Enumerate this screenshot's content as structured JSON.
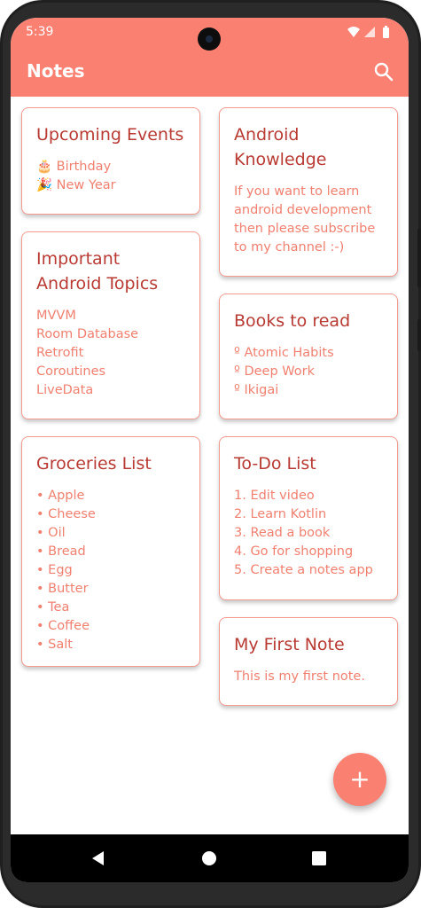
{
  "status_bar": {
    "time": "5:39",
    "icons": [
      "wifi-icon",
      "signal-icon",
      "battery-icon"
    ]
  },
  "app_bar": {
    "title": "Notes",
    "search_icon": "search-icon"
  },
  "colors": {
    "accent": "#fa8072",
    "title_text": "#b83a33",
    "body_text": "#f08070",
    "card_border": "#f39b8f"
  },
  "notes": [
    {
      "title": "Upcoming Events",
      "lines": [
        "🎂 Birthday",
        "🎉 New Year"
      ]
    },
    {
      "title": "Android Knowledge",
      "lines": [
        "If you want to learn",
        "android development",
        "then please subscribe",
        "to my channel :-)"
      ]
    },
    {
      "title": "Important Android Topics",
      "lines": [
        "MVVM",
        "Room Database",
        "Retrofit",
        "Coroutines",
        "LiveData"
      ]
    },
    {
      "title": "Books to read",
      "lines": [
        "º Atomic Habits",
        "º Deep Work",
        "º Ikigai"
      ]
    },
    {
      "title": "Groceries List",
      "lines": [
        "• Apple",
        "• Cheese",
        "• Oil",
        "• Bread",
        "• Egg",
        "• Butter",
        "• Tea",
        "• Coffee",
        "• Salt"
      ]
    },
    {
      "title": "To-Do List",
      "lines": [
        "1. Edit video",
        "2. Learn Kotlin",
        "3. Read a book",
        "4. Go for shopping",
        "5. Create a notes app"
      ]
    },
    {
      "title": "My First Note",
      "lines": [
        "This is my first note."
      ]
    }
  ],
  "fab": {
    "label": "+",
    "icon": "add-icon"
  },
  "nav_bar": {
    "icons": [
      "back-icon",
      "home-icon",
      "recents-icon"
    ]
  }
}
